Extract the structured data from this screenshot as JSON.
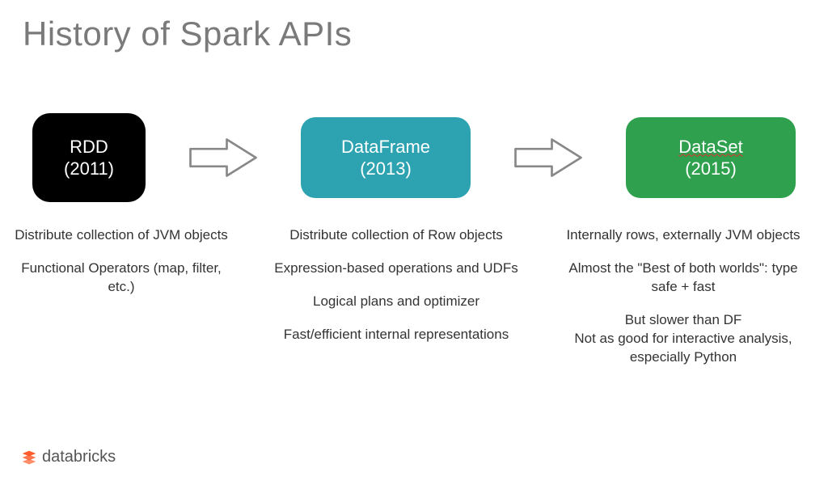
{
  "title": "History of Spark APIs",
  "nodes": {
    "rdd": {
      "name": "RDD",
      "year": "(2011)"
    },
    "dataframe": {
      "name": "DataFrame",
      "year": "(2013)"
    },
    "dataset": {
      "name": "DataSet",
      "year": "(2015)"
    }
  },
  "details": {
    "rdd": [
      "Distribute collection of JVM objects",
      "Functional Operators (map, filter, etc.)"
    ],
    "dataframe": [
      "Distribute collection of Row objects",
      "Expression-based operations and UDFs",
      "Logical plans and optimizer",
      "Fast/efficient internal representations"
    ],
    "dataset": [
      "Internally rows, externally JVM objects",
      "Almost the \"Best of both worlds\": type safe + fast",
      "But slower than DF\nNot as good for interactive analysis, especially Python"
    ]
  },
  "logo": "databricks"
}
